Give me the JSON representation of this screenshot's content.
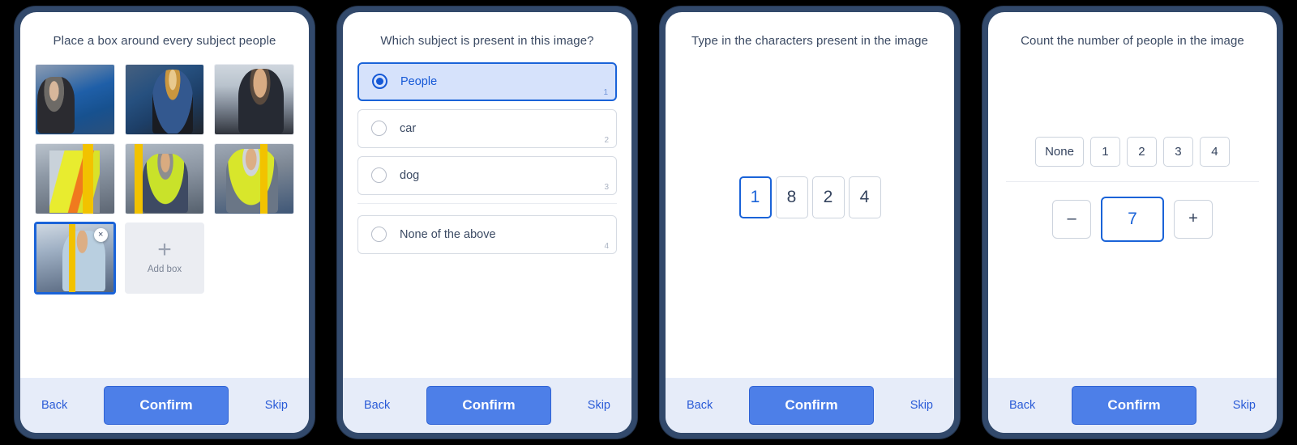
{
  "panels": [
    {
      "id": "bounding-box-task",
      "title": "Place a box around every subject people",
      "boxes": [
        {
          "label": "box-1"
        },
        {
          "label": "box-2"
        },
        {
          "label": "box-3"
        },
        {
          "label": "box-4"
        },
        {
          "label": "box-5"
        },
        {
          "label": "box-6"
        },
        {
          "label": "box-7-selected"
        }
      ],
      "selected_box_index": 6,
      "remove_icon": "×",
      "add_box": {
        "plus": "+",
        "label": "Add box"
      },
      "footer": {
        "back": "Back",
        "confirm": "Confirm",
        "skip": "Skip"
      }
    },
    {
      "id": "single-choice-task",
      "title": "Which subject is present in this image?",
      "options": [
        {
          "label": "People",
          "shortcut": "1",
          "selected": true
        },
        {
          "label": "car",
          "shortcut": "2",
          "selected": false
        },
        {
          "label": "dog",
          "shortcut": "3",
          "selected": false
        }
      ],
      "none_option": {
        "label": "None of the above",
        "shortcut": "4",
        "selected": false
      },
      "footer": {
        "back": "Back",
        "confirm": "Confirm",
        "skip": "Skip"
      }
    },
    {
      "id": "transcription-task",
      "title": "Type in the characters present in the image",
      "characters": [
        {
          "value": "1",
          "focused": true
        },
        {
          "value": "8",
          "focused": false
        },
        {
          "value": "2",
          "focused": false
        },
        {
          "value": "4",
          "focused": false
        }
      ],
      "footer": {
        "back": "Back",
        "confirm": "Confirm",
        "skip": "Skip"
      }
    },
    {
      "id": "counting-task",
      "title": "Count the number of people in the image",
      "quick_options": [
        "None",
        "1",
        "2",
        "3",
        "4"
      ],
      "stepper": {
        "decrement": "–",
        "value": "7",
        "increment": "+"
      },
      "footer": {
        "back": "Back",
        "confirm": "Confirm",
        "skip": "Skip"
      }
    }
  ],
  "colors": {
    "frame": "#32496b",
    "accent": "#1a63d8",
    "confirm_button": "#4d7fe8",
    "footer_background": "#e6ecf9",
    "title_text": "#3b4a63",
    "selected_option_background": "#d6e2fb"
  }
}
